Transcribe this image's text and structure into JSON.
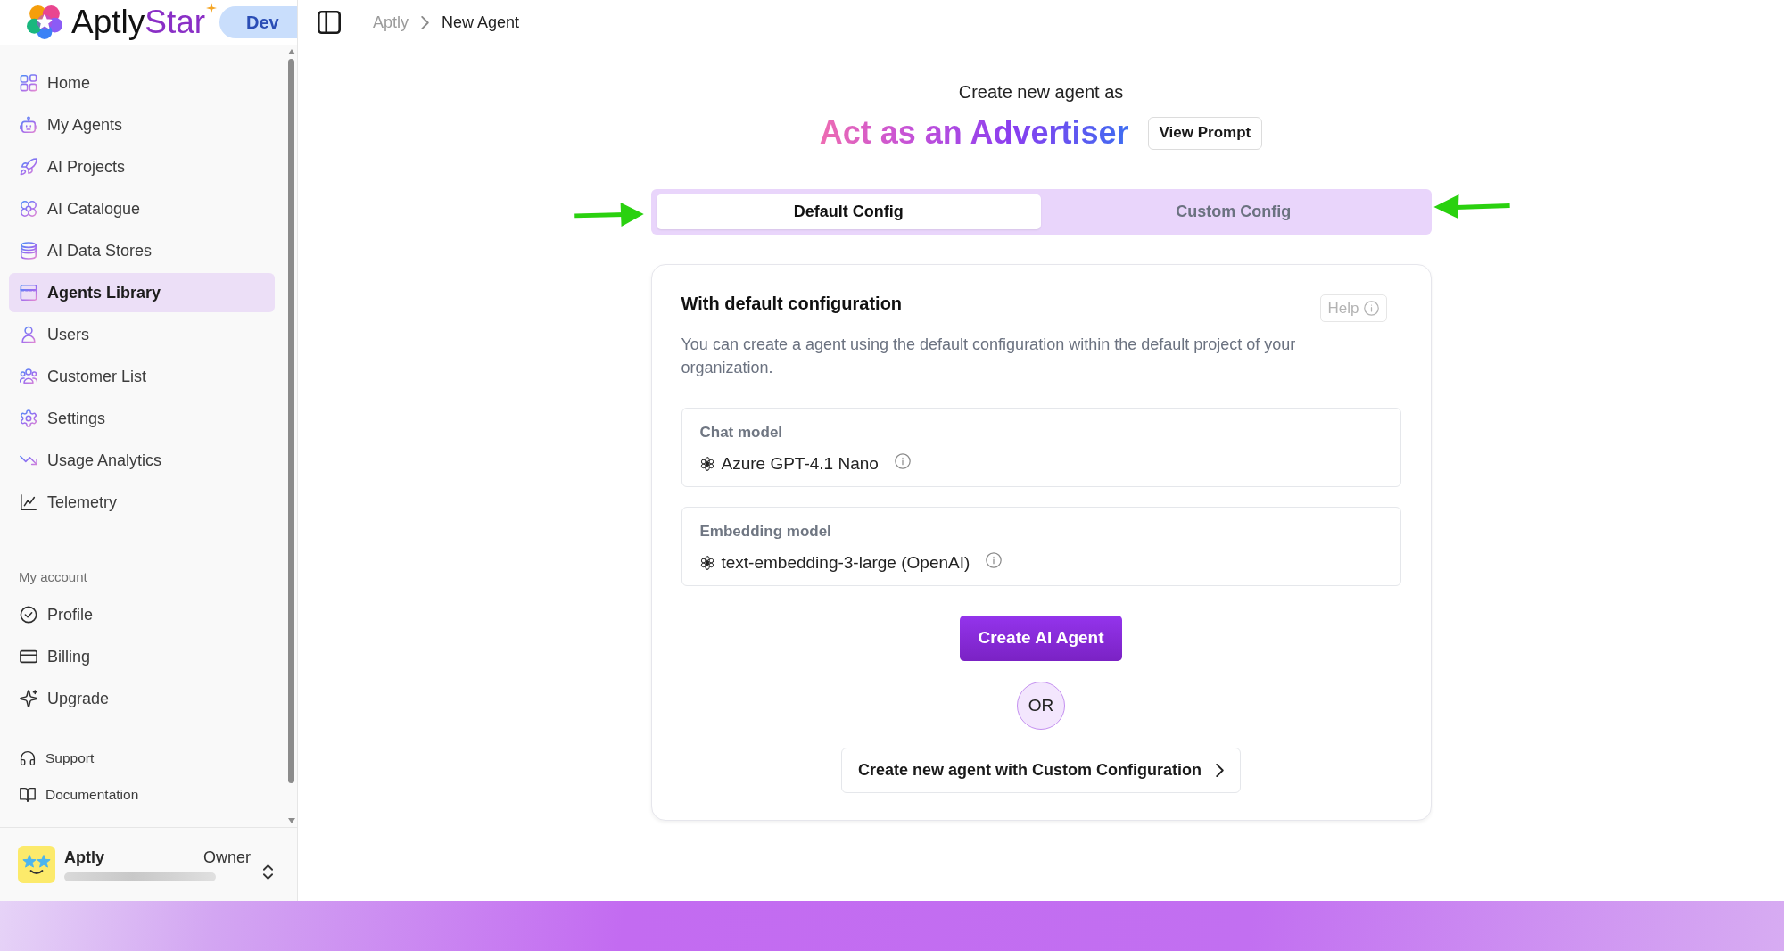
{
  "brand": {
    "name_part_1": "Aptly",
    "name_part_2": "Star",
    "environment_badge": "Dev"
  },
  "header": {
    "breadcrumbs": [
      {
        "label": "Aptly",
        "current": false
      },
      {
        "label": "New Agent",
        "current": true
      }
    ]
  },
  "sidebar": {
    "nav_items": [
      {
        "label": "Home",
        "selected": false
      },
      {
        "label": "My Agents",
        "selected": false
      },
      {
        "label": "AI Projects",
        "selected": false
      },
      {
        "label": "AI Catalogue",
        "selected": false
      },
      {
        "label": "AI Data Stores",
        "selected": false
      },
      {
        "label": "Agents Library",
        "selected": true
      },
      {
        "label": "Users",
        "selected": false
      },
      {
        "label": "Customer List",
        "selected": false
      },
      {
        "label": "Settings",
        "selected": false
      },
      {
        "label": "Usage Analytics",
        "selected": false
      },
      {
        "label": "Telemetry",
        "selected": false
      }
    ],
    "account_section": {
      "title": "My account",
      "items": [
        {
          "label": "Profile",
          "selected": false
        },
        {
          "label": "Billing",
          "selected": false
        },
        {
          "label": "Upgrade",
          "selected": false
        }
      ]
    },
    "help_items": [
      {
        "label": "Support",
        "selected": false
      },
      {
        "label": "Documentation",
        "selected": false
      }
    ],
    "user": {
      "name": "Aptly",
      "role": "Owner"
    }
  },
  "main": {
    "intro": "Create new agent as",
    "agent_title": "Act as an Advertiser",
    "view_prompt_button": "View Prompt",
    "tabs": [
      {
        "label": "Default Config",
        "selected": true
      },
      {
        "label": "Custom Config",
        "selected": false
      }
    ],
    "card": {
      "title": "With default configuration",
      "help_button": "Help",
      "description": "You can create a agent using the default configuration within the default project of your organization.",
      "models": [
        {
          "label": "Chat model",
          "value": "Azure GPT-4.1 Nano"
        },
        {
          "label": "Embedding model",
          "value": "text-embedding-3-large (OpenAI)"
        }
      ],
      "create_button": "Create AI Agent",
      "or_text": "OR",
      "custom_button": "Create new agent with Custom Configuration"
    }
  }
}
